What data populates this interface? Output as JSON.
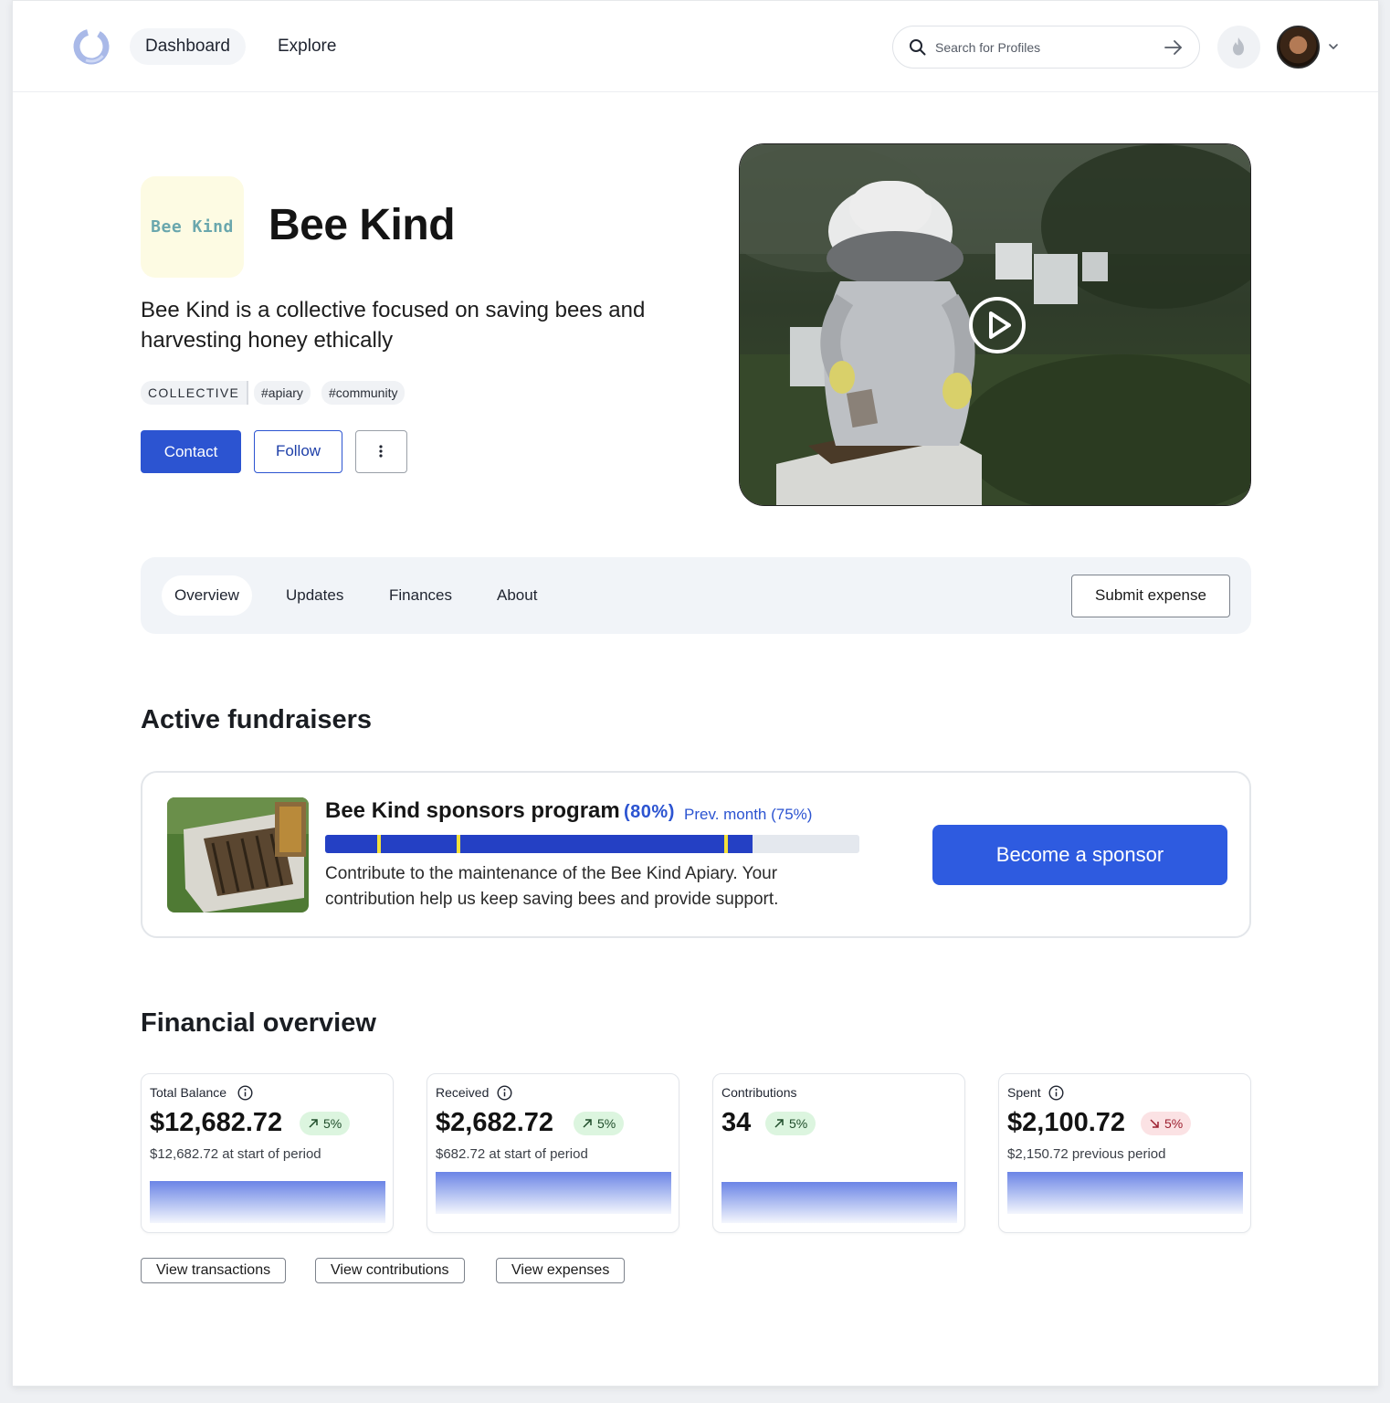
{
  "header": {
    "nav": [
      {
        "label": "Dashboard",
        "active": true
      },
      {
        "label": "Explore",
        "active": false
      }
    ],
    "search": {
      "placeholder": "Search for Profiles"
    }
  },
  "profile": {
    "logo_text": "Bee Kind",
    "name": "Bee Kind",
    "description": "Bee Kind is a collective focused on saving bees and harvesting honey ethically",
    "type_tag": "COLLECTIVE",
    "tags": [
      "#apiary",
      "#community"
    ],
    "buttons": {
      "contact": "Contact",
      "follow": "Follow"
    }
  },
  "tabs": {
    "items": [
      {
        "label": "Overview",
        "active": true
      },
      {
        "label": "Updates",
        "active": false
      },
      {
        "label": "Finances",
        "active": false
      },
      {
        "label": "About",
        "active": false
      }
    ],
    "submit_label": "Submit expense"
  },
  "fundraisers": {
    "title": "Active fundraisers",
    "items": [
      {
        "title": "Bee Kind sponsors program",
        "percent_label": "(80%)",
        "prev_label": "Prev. month (75%)",
        "progress": 0.8,
        "milestones": [
          0.1,
          0.25,
          0.75
        ],
        "description": "Contribute to the maintenance of the Bee Kind Apiary. Your contribution help us keep saving bees and provide support.",
        "cta": "Become a sponsor"
      }
    ]
  },
  "financial": {
    "title": "Financial overview",
    "stats": [
      {
        "label": "Total Balance",
        "info": true,
        "value": "$12,682.72",
        "change": "5%",
        "direction": "up",
        "sub": "$12,682.72 at start of period"
      },
      {
        "label": "Received",
        "info": true,
        "value": "$2,682.72",
        "change": "5%",
        "direction": "up",
        "sub": "$682.72 at start of period"
      },
      {
        "label": "Contributions",
        "info": false,
        "value": "34",
        "change": "5%",
        "direction": "up",
        "sub": ""
      },
      {
        "label": "Spent",
        "info": true,
        "value": "$2,100.72",
        "change": "5%",
        "direction": "down",
        "sub": "$2,150.72 previous period"
      }
    ],
    "links": [
      "View transactions",
      "View contributions",
      "View expenses"
    ]
  },
  "colors": {
    "primary": "#2c54d1",
    "sponsor_button": "#2e5be0",
    "progress_fill": "#2440c4",
    "milestone": "#f3e13a",
    "badge_up_bg": "#dcf5df",
    "badge_down_bg": "#fbe2e4"
  },
  "icons": {
    "logo": "ring-logo-icon",
    "search": "search-icon",
    "submit_search": "arrow-right-icon",
    "notifications": "flame-icon",
    "account_menu": "chevron-down-icon",
    "more": "more-vertical-icon",
    "video": "play-icon",
    "info": "info-icon",
    "trend_up": "arrow-up-right-icon",
    "trend_down": "arrow-down-right-icon"
  }
}
